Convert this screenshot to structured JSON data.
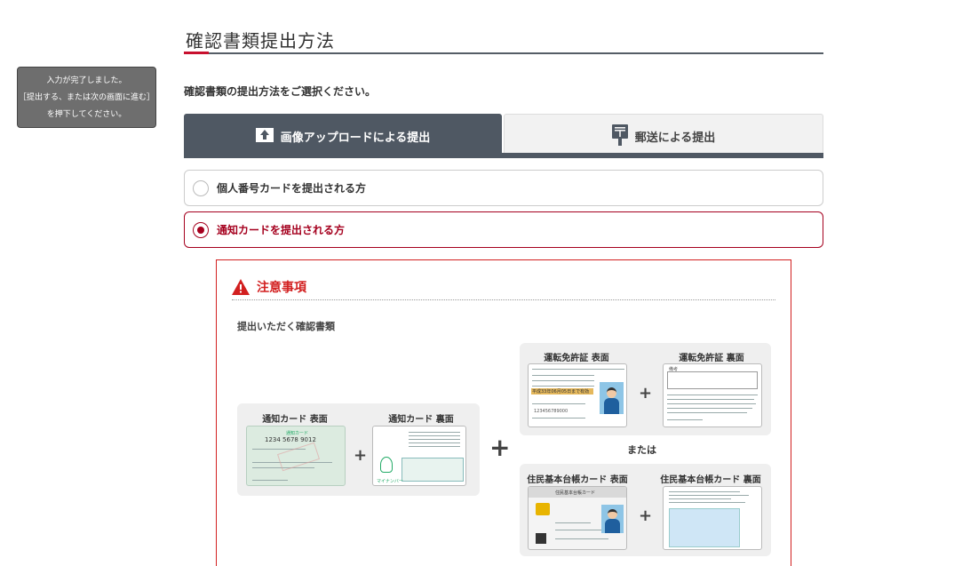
{
  "tooltip": {
    "line1": "入力が完了しました。",
    "line2": "［提出する、または次の画面に進む］",
    "line3": "を押下してください。"
  },
  "page": {
    "title": "確認書類提出方法",
    "instruction": "確認書類の提出方法をご選択ください。"
  },
  "tabs": {
    "upload_label": "画像アップロードによる提出",
    "mail_label": "郵送による提出",
    "active": "upload"
  },
  "options": {
    "mynumber_label": "個人番号カードを提出される方",
    "notification_label": "通知カードを提出される方",
    "selected": "notification"
  },
  "notice": {
    "title": "注意事項",
    "subtitle": "提出いただく確認書類",
    "notif_front": "通知カード 表面",
    "notif_back": "通知カード 裏面",
    "license_front": "運転免許証 表面",
    "license_back": "運転免許証 裏面",
    "or_label": "または",
    "resident_front": "住民基本台帳カード 表面",
    "resident_back": "住民基本台帳カード 裏面",
    "card_number": "1234 5678 9012",
    "card_title": "通知カード",
    "resident_card_title": "住民基本台帳カード",
    "license_number": "123456789000",
    "license_expiry": "平成33年06月05日まで有効",
    "license_back_header": "備考",
    "mynumber_small": "マイナンバー"
  },
  "colors": {
    "accent_red": "#c8102e",
    "tab_active": "#4f5863",
    "selected_option": "#a5001e",
    "notice_border": "#d21f1f"
  }
}
